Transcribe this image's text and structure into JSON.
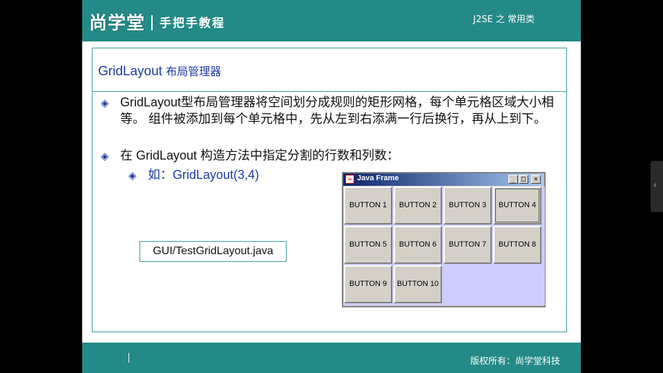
{
  "header": {
    "logo": "尚学堂",
    "tagline": "手把手教程",
    "course": "J2SE 之 常用类"
  },
  "title": {
    "en": "GridLayout",
    "cn": "布局管理器"
  },
  "bullets": [
    "GridLayout型布局管理器将空间划分成规则的矩形网格，每个单元格区域大小相等。 组件被添加到每个单元格中，先从左到右添满一行后换行，再从上到下。",
    "在 GridLayout 构造方法中指定分割的行数和列数："
  ],
  "sub_bullet": "如：GridLayout(3,4)",
  "file_label": "GUI/TestGridLayout.java",
  "java_frame": {
    "title": "Java Frame",
    "minimize": "_",
    "maximize": "□",
    "close": "✕",
    "buttons": [
      "BUTTON 1",
      "BUTTON 2",
      "BUTTON 3",
      "BUTTON 4",
      "BUTTON 5",
      "BUTTON 6",
      "BUTTON 7",
      "BUTTON 8",
      "BUTTON 9",
      "BUTTON 10"
    ],
    "empty_cell_color": "#ccccff"
  },
  "footer": {
    "copyright": "版权所有：尚学堂科技"
  },
  "colors": {
    "teal": "#238a87",
    "title_blue": "#1c3aa3"
  },
  "icons": {
    "bullet": "diamond-bullet-icon",
    "side_tab": "chevron-left-icon"
  }
}
